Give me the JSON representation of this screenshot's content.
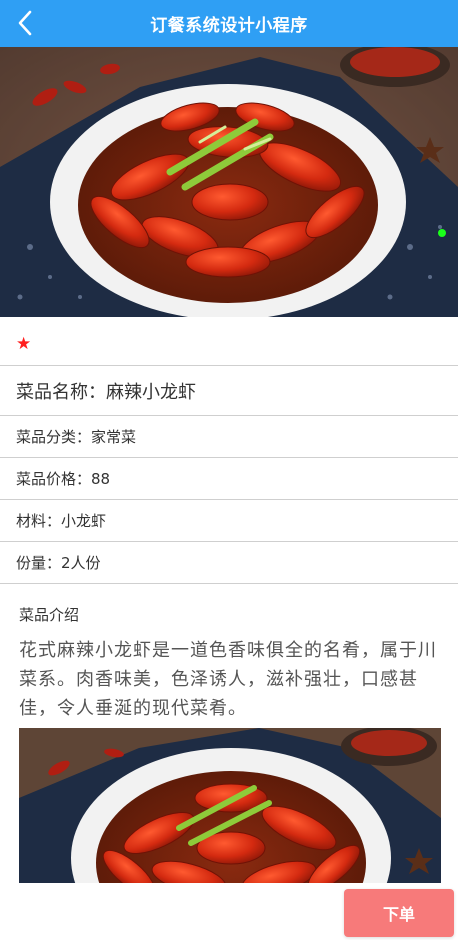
{
  "header": {
    "title": "订餐系统设计小程序",
    "back_icon": "chevron-left-icon",
    "background": "#2f9ff4"
  },
  "hero": {
    "image_subject": "麻辣小龙虾",
    "active_dot_color": "#1aff1a"
  },
  "rating": {
    "icon": "star-icon",
    "glyph": "★",
    "stars": 1,
    "color": "#ff1e1e"
  },
  "details": {
    "name_label": "菜品名称：",
    "name_value": "麻辣小龙虾",
    "category_label": "菜品分类：",
    "category_value": "家常菜",
    "price_label": "菜品价格：",
    "price_value": "88",
    "material_label": "材料：",
    "material_value": "小龙虾",
    "portion_label": "份量：",
    "portion_value": "2人份"
  },
  "intro": {
    "title": "菜品介绍",
    "text": "花式麻辣小龙虾是一道色香味俱全的名肴，属于川菜系。肉香味美，色泽诱人，滋补强壮，口感甚佳，令人垂涎的现代菜肴。"
  },
  "order_button": {
    "label": "下单",
    "color": "#f77a7a"
  }
}
